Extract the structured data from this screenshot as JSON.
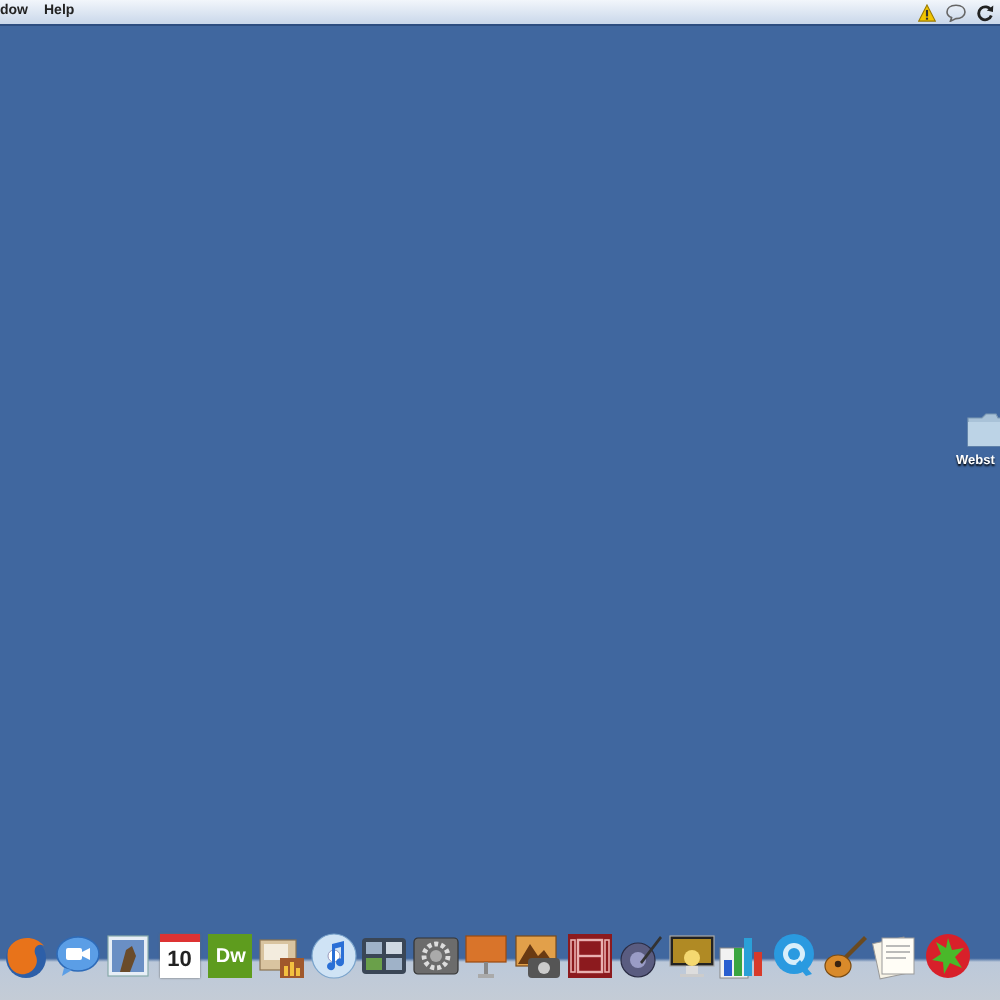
{
  "menu_bar": {
    "items": [
      "dow",
      "Help"
    ]
  },
  "desktop_items": [
    {
      "label": "Webst"
    }
  ],
  "dock": {
    "calendar_day": "10",
    "dreamweaver_label": "Dw"
  }
}
